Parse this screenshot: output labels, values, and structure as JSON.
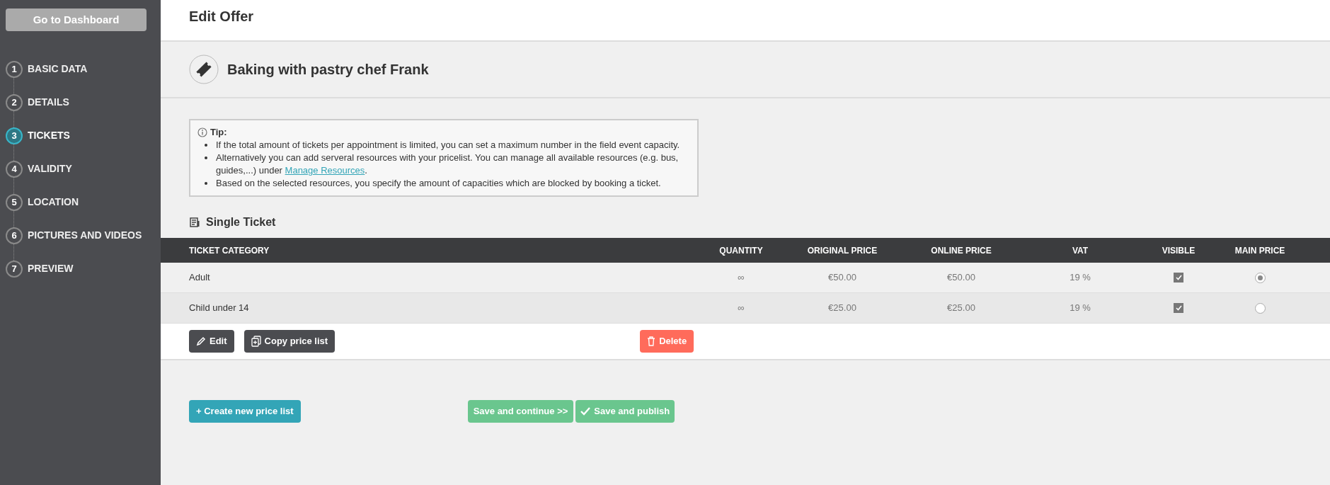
{
  "sidebar": {
    "dashboard_button": "Go to Dashboard",
    "steps": [
      {
        "number": "1",
        "label": "BASIC DATA",
        "selected": false
      },
      {
        "number": "2",
        "label": "DETAILS",
        "selected": false
      },
      {
        "number": "3",
        "label": "TICKETS",
        "selected": true
      },
      {
        "number": "4",
        "label": "VALIDITY",
        "selected": false
      },
      {
        "number": "5",
        "label": "LOCATION",
        "selected": false
      },
      {
        "number": "6",
        "label": "PICTURES AND VIDEOS",
        "selected": false
      },
      {
        "number": "7",
        "label": "PREVIEW",
        "selected": false
      }
    ]
  },
  "header": {
    "title": "Edit Offer"
  },
  "offer": {
    "title": "Baking with pastry chef Frank"
  },
  "tip": {
    "title": "Tip:",
    "items": [
      {
        "text": "If the total amount of tickets per appointment is limited, you can set a maximum number in the field event capacity."
      },
      {
        "text": "Alternatively you can add serveral resources with your pricelist. You can manage all available resources (e.g. bus, guides,...) under",
        "link": "Manage Resources",
        "after": "."
      },
      {
        "text": "Based on the selected resources, you specify the amount of capacities which are blocked by booking a ticket."
      }
    ]
  },
  "price_list": {
    "title": "Single Ticket",
    "columns": [
      "TICKET CATEGORY",
      "QUANTITY",
      "ORIGINAL PRICE",
      "ONLINE PRICE",
      "VAT",
      "VISIBLE",
      "MAIN PRICE"
    ],
    "rows": [
      {
        "category": "Adult",
        "quantity": "∞",
        "original_price": "€50.00",
        "online_price": "€50.00",
        "vat": "19 %",
        "visible": true,
        "main_price": true
      },
      {
        "category": "Child under 14",
        "quantity": "∞",
        "original_price": "€25.00",
        "online_price": "€25.00",
        "vat": "19 %",
        "visible": true,
        "main_price": false
      }
    ],
    "buttons": {
      "edit": "Edit",
      "copy": "Copy price list",
      "delete": "Delete"
    }
  },
  "footer": {
    "create": "+ Create new price list",
    "save_continue": "Save and continue >>",
    "save_publish": "Save and publish"
  }
}
